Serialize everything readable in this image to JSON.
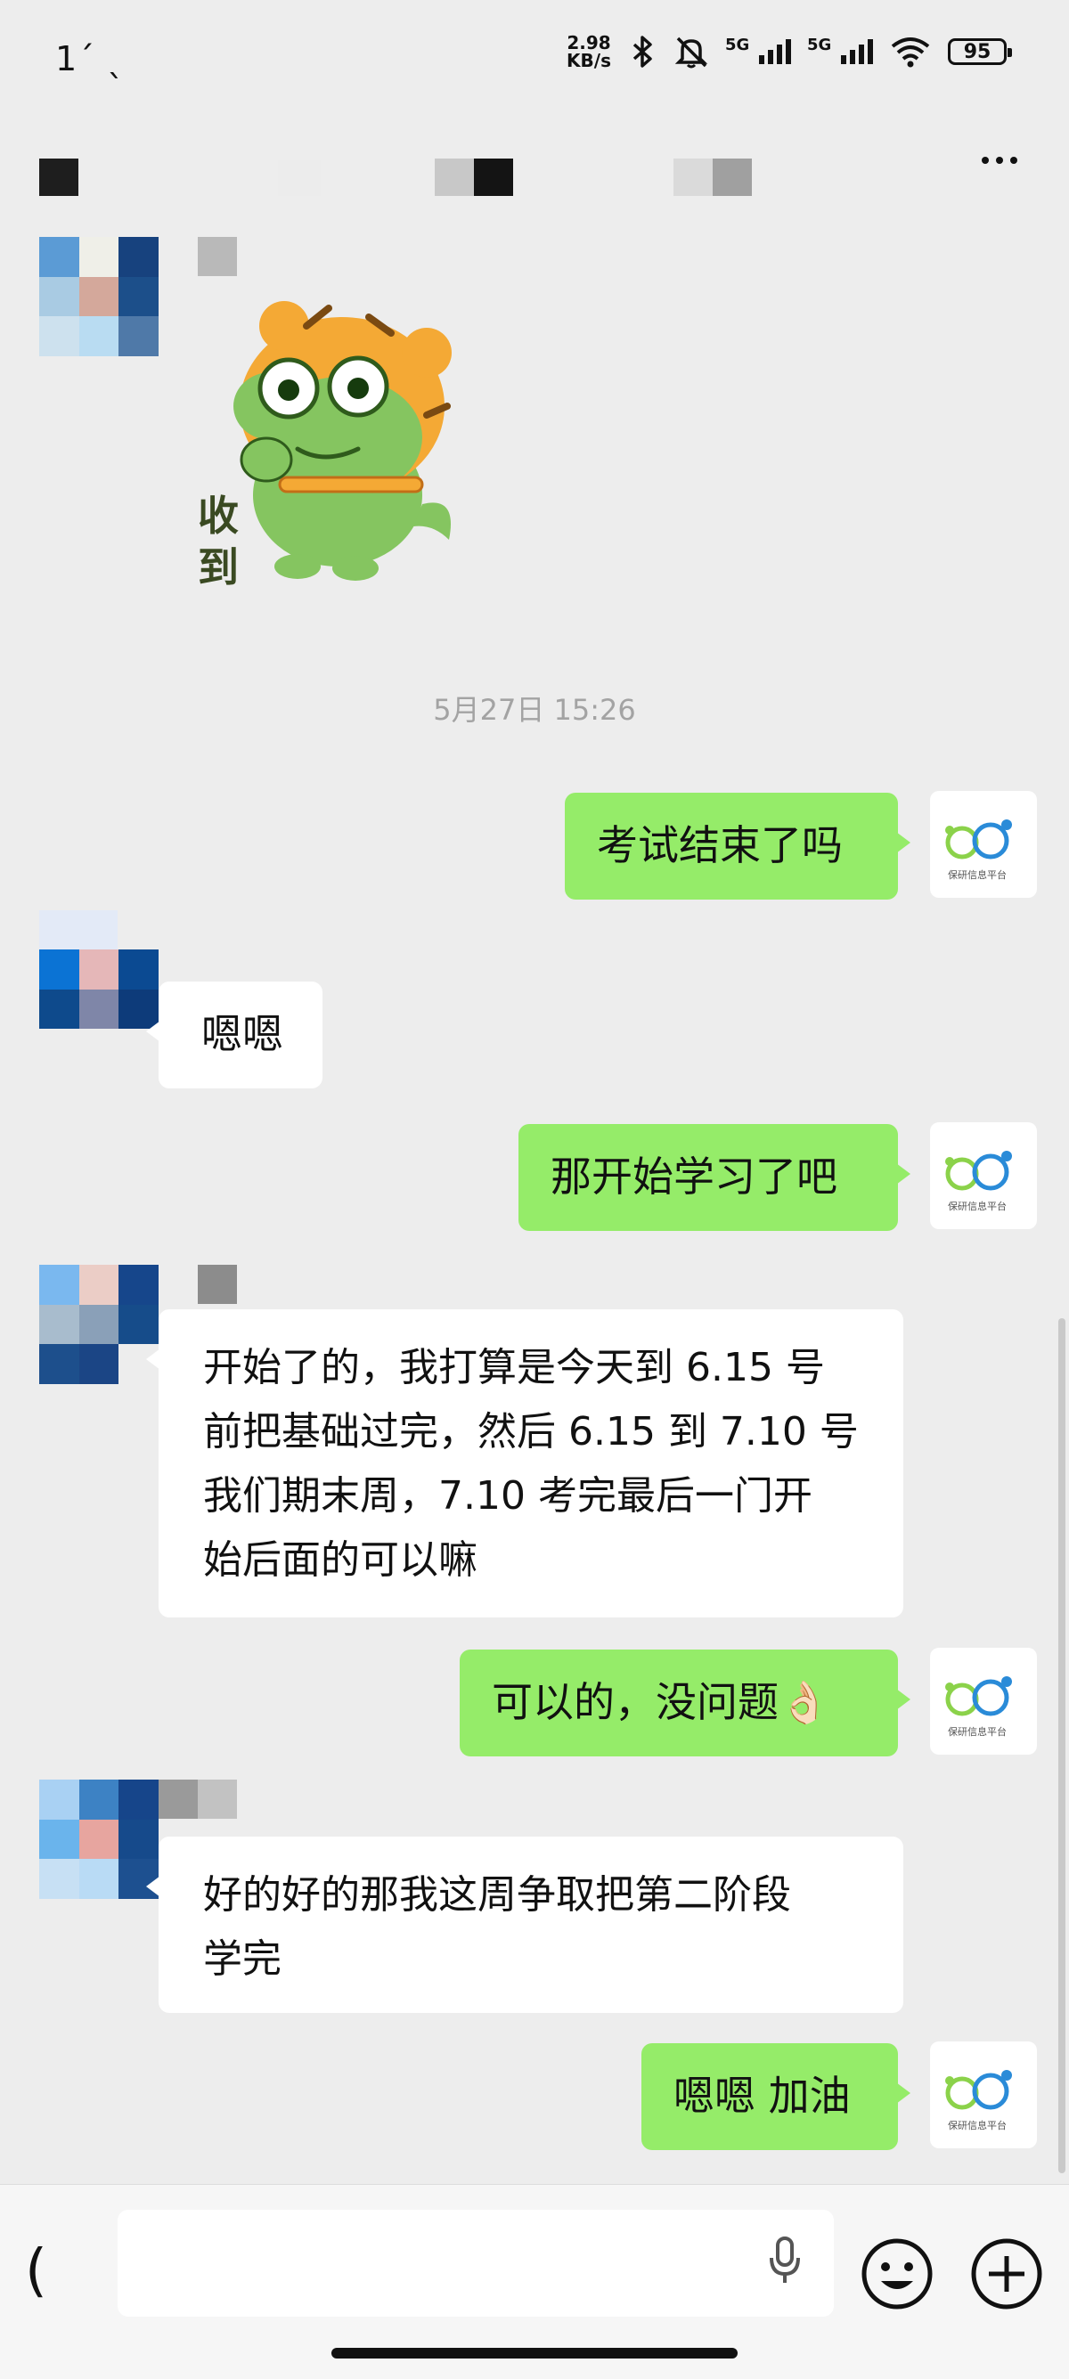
{
  "status_bar": {
    "time": "1´ ˎ",
    "net_speed_value": "2.98",
    "net_speed_unit": "KB/s",
    "signal_label_1": "5G",
    "signal_label_2": "5G",
    "battery": "95"
  },
  "chat": {
    "timestamp": "5月27日 15:26",
    "sticker_caption": "收\n到",
    "messages": [
      {
        "side": "out",
        "text": "考试结束了吗"
      },
      {
        "side": "in",
        "text": "嗯嗯"
      },
      {
        "side": "out",
        "text": "那开始学习了吧"
      },
      {
        "side": "in",
        "text": "开始了的，我打算是今天到 6.15 号\n前把基础过完，然后 6.15 到 7.10 号\n我们期末周，7.10 考完最后一门开\n始后面的可以嘛"
      },
      {
        "side": "out",
        "text": "可以的，没问题👌🏻"
      },
      {
        "side": "in",
        "text": "好的好的那我这周争取把第二阶段\n学完"
      },
      {
        "side": "out",
        "text": "嗯嗯 加油"
      }
    ]
  },
  "input_bar": {
    "voice_toggle_glyph": "(",
    "input_value": ""
  },
  "colors": {
    "outgoing_bubble": "#95ec69",
    "incoming_bubble": "#ffffff",
    "background": "#ededed"
  }
}
